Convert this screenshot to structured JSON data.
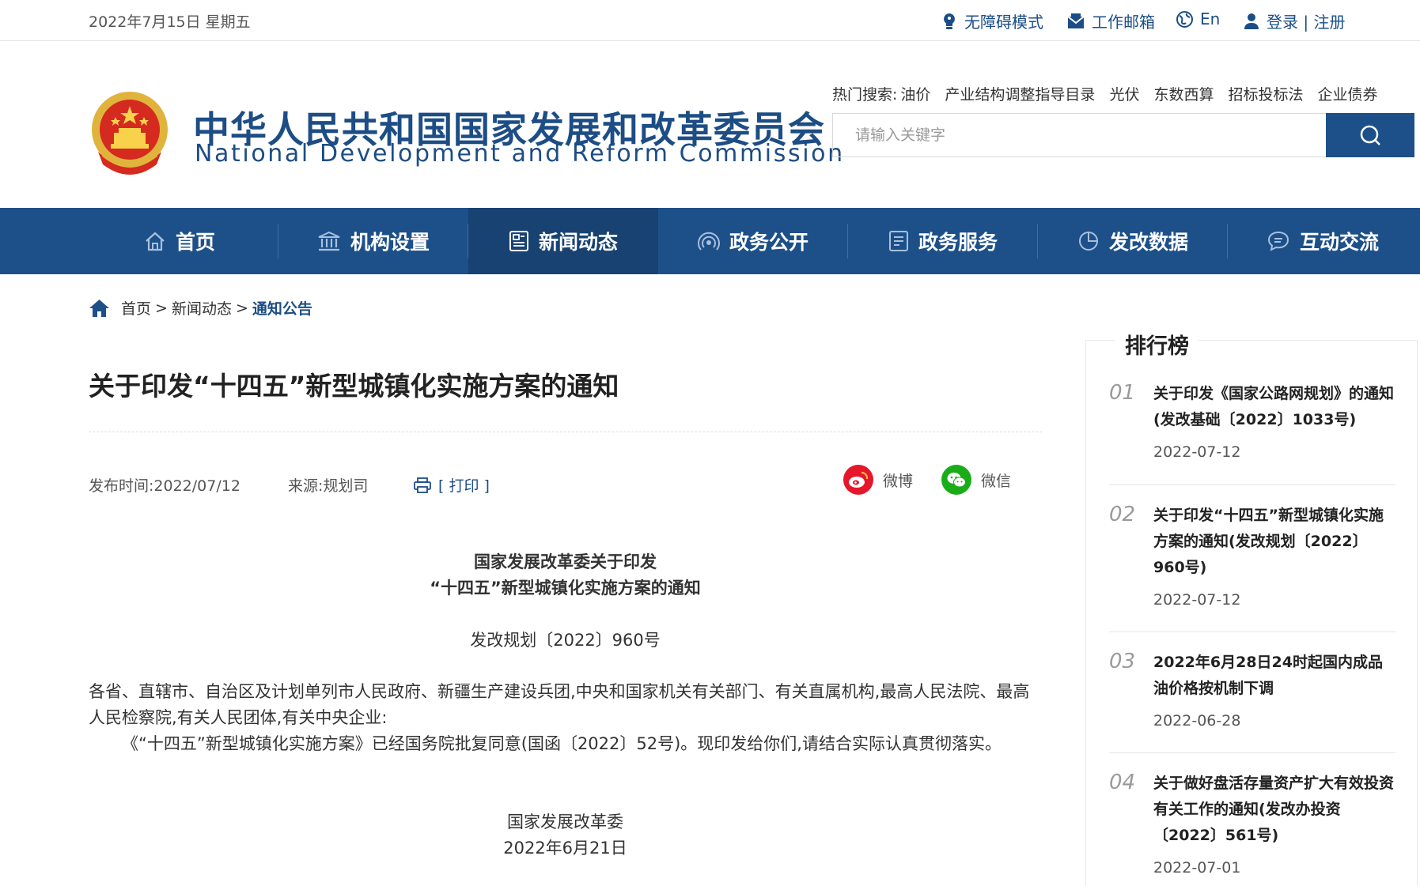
{
  "topbar": {
    "date": "2022年7月15日 星期五",
    "accessibility": "无障碍模式",
    "mail": "工作邮箱",
    "english": "En",
    "login": "登录 | 注册"
  },
  "header": {
    "title_cn": "中华人民共和国国家发展和改革委员会",
    "title_en": "National Development and Reform Commission",
    "hot_label": "热门搜索:",
    "hot_terms": [
      "油价",
      "产业结构调整指导目录",
      "光伏",
      "东数西算",
      "招标投标法",
      "企业债券"
    ],
    "search_placeholder": "请输入关键字"
  },
  "nav": {
    "items": [
      {
        "label": "首页",
        "icon": "home-icon"
      },
      {
        "label": "机构设置",
        "icon": "institution-icon"
      },
      {
        "label": "新闻动态",
        "icon": "news-icon"
      },
      {
        "label": "政务公开",
        "icon": "broadcast-icon"
      },
      {
        "label": "政务服务",
        "icon": "document-icon"
      },
      {
        "label": "发改数据",
        "icon": "pie-chart-icon"
      },
      {
        "label": "互动交流",
        "icon": "chat-icon"
      }
    ],
    "active_index": 2
  },
  "breadcrumb": {
    "home": "首页",
    "sep": ">",
    "level2": "新闻动态",
    "current": "通知公告"
  },
  "article": {
    "title": "关于印发“十四五”新型城镇化实施方案的通知",
    "publish": "发布时间:2022/07/12",
    "source": "来源:规划司",
    "print": "[ 打印 ]",
    "share_weibo": "微博",
    "share_weixin": "微信",
    "heading_line1": "国家发展改革委关于印发",
    "heading_line2": "“十四五”新型城镇化实施方案的通知",
    "doc_no": "发改规划〔2022〕960号",
    "para1": "各省、直辖市、自治区及计划单列市人民政府、新疆生产建设兵团,中央和国家机关有关部门、有关直属机构,最高人民法院、最高人民检察院,有关人民团体,有关中央企业:",
    "para2": "《“十四五”新型城镇化实施方案》已经国务院批复同意(国函〔2022〕52号)。现印发给你们,请结合实际认真贯彻落实。",
    "signer": "国家发展改革委",
    "sign_date": "2022年6月21日"
  },
  "ranking": {
    "title": "排行榜",
    "items": [
      {
        "num": "01",
        "text": "关于印发《国家公路网规划》的通知(发改基础〔2022〕1033号)",
        "date": "2022-07-12"
      },
      {
        "num": "02",
        "text": "关于印发“十四五”新型城镇化实施方案的通知(发改规划〔2022〕960号)",
        "date": "2022-07-12"
      },
      {
        "num": "03",
        "text": "2022年6月28日24时起国内成品油价格按机制下调",
        "date": "2022-06-28"
      },
      {
        "num": "04",
        "text": "关于做好盘活存量资产扩大有效投资有关工作的通知(发改办投资〔2022〕561号)",
        "date": "2022-07-01"
      }
    ]
  },
  "colors": {
    "brand_blue": "#1d5089",
    "nav_active": "#174272",
    "weibo_red": "#e6162d",
    "wechat_green": "#1aad19"
  }
}
